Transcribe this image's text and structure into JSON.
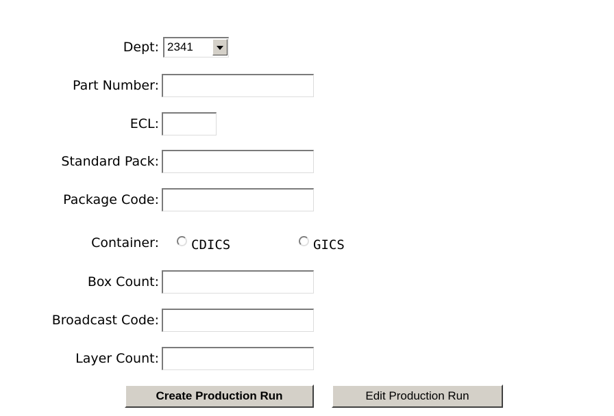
{
  "form": {
    "dept": {
      "label": "Dept:",
      "selected": "2341"
    },
    "part_number": {
      "label": "Part Number:",
      "value": ""
    },
    "ecl": {
      "label": "ECL:",
      "value": ""
    },
    "standard_pack": {
      "label": "Standard Pack:",
      "value": ""
    },
    "package_code": {
      "label": "Package Code:",
      "value": ""
    },
    "container": {
      "label": "Container:",
      "options": [
        {
          "label": "CDICS",
          "checked": false
        },
        {
          "label": "GICS",
          "checked": false
        }
      ]
    },
    "box_count": {
      "label": "Box Count:",
      "value": ""
    },
    "broadcast_code": {
      "label": "Broadcast Code:",
      "value": ""
    },
    "layer_count": {
      "label": "Layer Count:",
      "value": ""
    }
  },
  "actions": {
    "create_label": "Create Production Run",
    "edit_label": "Edit Production Run"
  },
  "colors": {
    "background": "#ffffff",
    "button_face": "#d4d0c8"
  }
}
